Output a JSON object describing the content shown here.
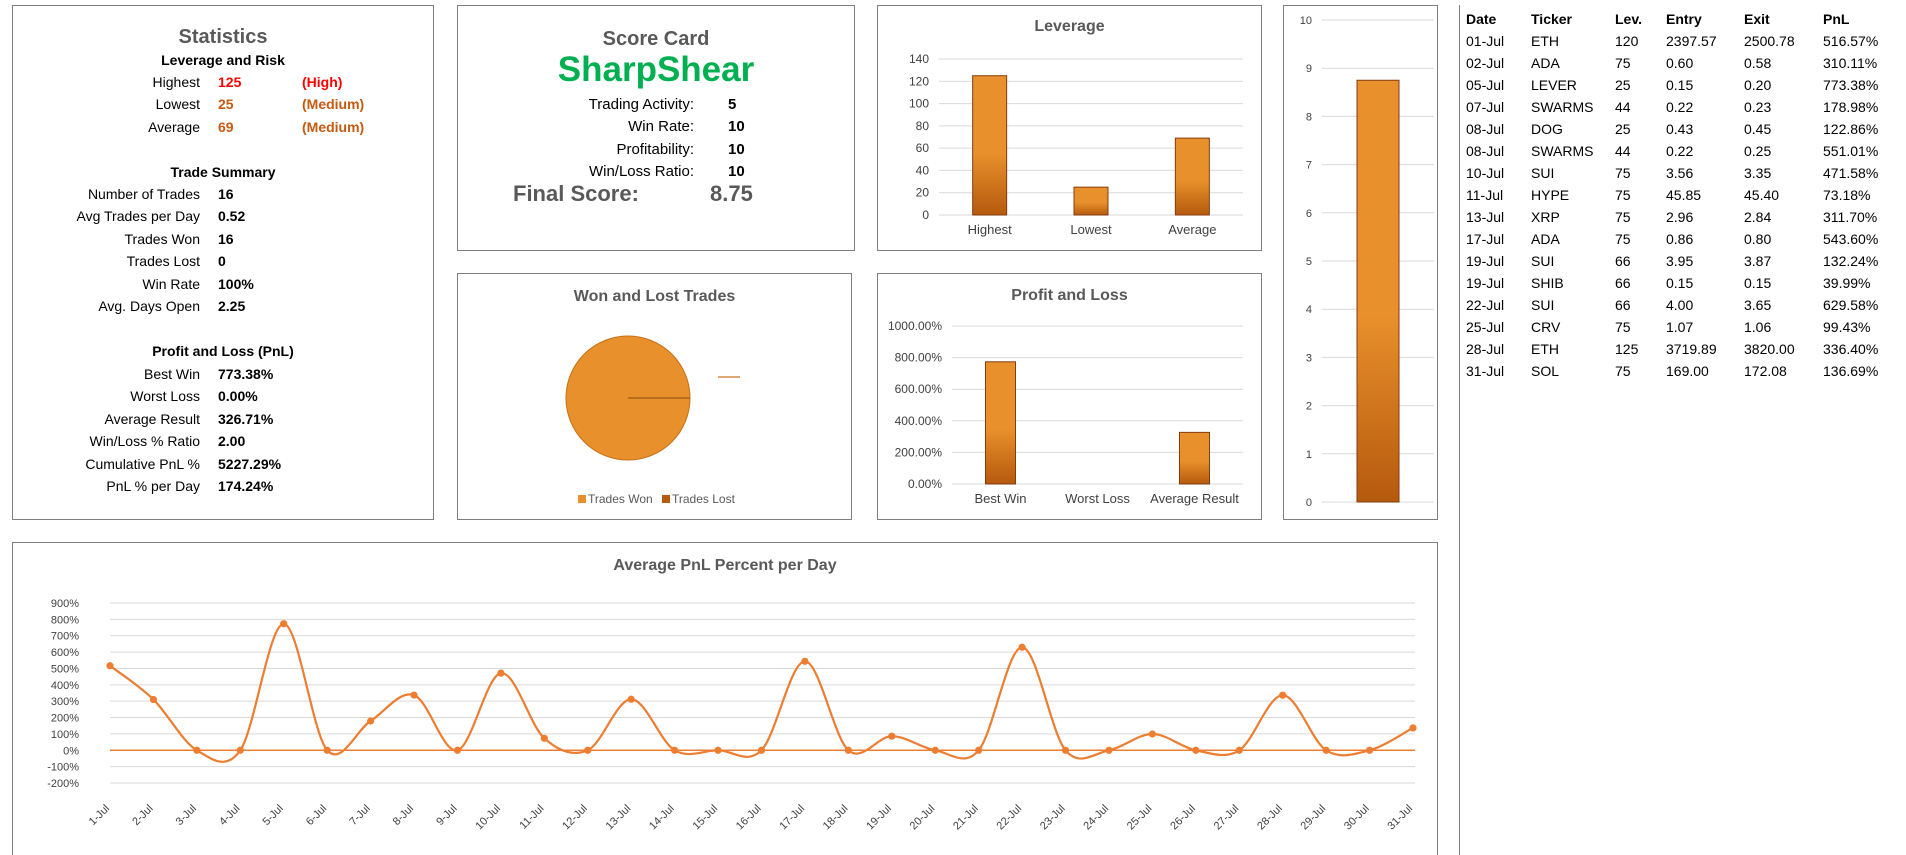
{
  "statistics": {
    "title": "Statistics",
    "leverage_heading": "Leverage and Risk",
    "leverage_rows": [
      {
        "label": "Highest",
        "value": "125",
        "tag": "(High)"
      },
      {
        "label": "Lowest",
        "value": "25",
        "tag": "(Medium)"
      },
      {
        "label": "Average",
        "value": "69",
        "tag": "(Medium)"
      }
    ],
    "trade_heading": "Trade Summary",
    "trade_rows": [
      {
        "label": "Number of Trades",
        "value": "16"
      },
      {
        "label": "Avg Trades per Day",
        "value": "0.52"
      },
      {
        "label": "Trades Won",
        "value": "16"
      },
      {
        "label": "Trades Lost",
        "value": "0"
      },
      {
        "label": "Win Rate",
        "value": "100%"
      },
      {
        "label": "Avg. Days Open",
        "value": "2.25"
      }
    ],
    "pnl_heading": "Profit and Loss (PnL)",
    "pnl_rows": [
      {
        "label": "Best Win",
        "value": "773.38%"
      },
      {
        "label": "Worst Loss",
        "value": "0.00%"
      },
      {
        "label": "Average Result",
        "value": "326.71%"
      },
      {
        "label": "Win/Loss % Ratio",
        "value": "2.00"
      },
      {
        "label": "Cumulative PnL %",
        "value": "5227.29%"
      },
      {
        "label": "PnL % per Day",
        "value": "174.24%"
      }
    ]
  },
  "scorecard": {
    "title": "Score Card",
    "brand": "SharpShear",
    "rows": [
      {
        "label": "Trading Activity:",
        "value": "5"
      },
      {
        "label": "Win Rate:",
        "value": "10"
      },
      {
        "label": "Profitability:",
        "value": "10"
      },
      {
        "label": "Win/Loss Ratio:",
        "value": "10"
      }
    ],
    "final_label": "Final Score:",
    "final_value": "8.75"
  },
  "colors": {
    "bar_top": "#e8912c",
    "bar_bottom": "#b55a0e",
    "line": "#ed7d31",
    "pie_won": "#e8912c",
    "pie_lost": "#b55a0e",
    "brand": "#00b050",
    "high": "#ff0000",
    "medium": "#c55a11"
  },
  "chart_data": [
    {
      "id": "leverage",
      "type": "bar",
      "title": "Leverage",
      "categories": [
        "Highest",
        "Lowest",
        "Average"
      ],
      "values": [
        125,
        25,
        69
      ],
      "ylim": [
        0,
        140
      ],
      "yticks": [
        "0",
        "20",
        "40",
        "60",
        "80",
        "100",
        "120",
        "140"
      ],
      "grid": true
    },
    {
      "id": "score",
      "type": "bar",
      "title": "",
      "categories": [
        ""
      ],
      "values": [
        8.75
      ],
      "ylim": [
        0,
        10
      ],
      "yticks": [
        "0",
        "1",
        "2",
        "3",
        "4",
        "5",
        "6",
        "7",
        "8",
        "9",
        "10"
      ],
      "grid": true
    },
    {
      "id": "wonlost",
      "type": "pie",
      "title": "Won and Lost Trades",
      "labels": [
        "Trades Won",
        "Trades Lost"
      ],
      "values": [
        16,
        0
      ],
      "legend": "bottom"
    },
    {
      "id": "pnl",
      "type": "bar",
      "title": "Profit and Loss",
      "categories": [
        "Best Win",
        "Worst Loss",
        "Average Result"
      ],
      "values": [
        773.38,
        0,
        326.71
      ],
      "ylim": [
        0,
        1000
      ],
      "yticks": [
        "0.00%",
        "200.00%",
        "400.00%",
        "600.00%",
        "800.00%",
        "1000.00%"
      ],
      "grid": true
    },
    {
      "id": "avgpnl",
      "type": "line",
      "title": "Average PnL Percent per Day",
      "categories": [
        "1-Jul",
        "2-Jul",
        "3-Jul",
        "4-Jul",
        "5-Jul",
        "6-Jul",
        "7-Jul",
        "8-Jul",
        "9-Jul",
        "10-Jul",
        "11-Jul",
        "12-Jul",
        "13-Jul",
        "14-Jul",
        "15-Jul",
        "16-Jul",
        "17-Jul",
        "18-Jul",
        "19-Jul",
        "20-Jul",
        "21-Jul",
        "22-Jul",
        "23-Jul",
        "24-Jul",
        "25-Jul",
        "26-Jul",
        "27-Jul",
        "28-Jul",
        "29-Jul",
        "30-Jul",
        "31-Jul"
      ],
      "values": [
        516.57,
        310.11,
        0,
        0,
        773.38,
        0,
        178.98,
        337.43,
        0,
        471.58,
        73.18,
        0,
        311.7,
        0,
        0,
        0,
        543.6,
        0,
        86.12,
        0,
        0,
        629.58,
        0,
        0,
        99.43,
        0,
        0,
        336.4,
        0,
        0,
        136.69
      ],
      "ylim": [
        -200,
        900
      ],
      "yticks": [
        "-200%",
        "-100%",
        "0%",
        "100%",
        "200%",
        "300%",
        "400%",
        "500%",
        "600%",
        "700%",
        "800%",
        "900%"
      ],
      "grid": true
    }
  ],
  "trades": {
    "headers": [
      "Date",
      "Ticker",
      "Lev.",
      "Entry",
      "Exit",
      "PnL"
    ],
    "rows": [
      [
        "01-Jul",
        "ETH",
        "120",
        "2397.57",
        "2500.78",
        "516.57%"
      ],
      [
        "02-Jul",
        "ADA",
        "75",
        "0.60",
        "0.58",
        "310.11%"
      ],
      [
        "05-Jul",
        "LEVER",
        "25",
        "0.15",
        "0.20",
        "773.38%"
      ],
      [
        "07-Jul",
        "SWARMS",
        "44",
        "0.22",
        "0.23",
        "178.98%"
      ],
      [
        "08-Jul",
        "DOG",
        "25",
        "0.43",
        "0.45",
        "122.86%"
      ],
      [
        "08-Jul",
        "SWARMS",
        "44",
        "0.22",
        "0.25",
        "551.01%"
      ],
      [
        "10-Jul",
        "SUI",
        "75",
        "3.56",
        "3.35",
        "471.58%"
      ],
      [
        "11-Jul",
        "HYPE",
        "75",
        "45.85",
        "45.40",
        "73.18%"
      ],
      [
        "13-Jul",
        "XRP",
        "75",
        "2.96",
        "2.84",
        "311.70%"
      ],
      [
        "17-Jul",
        "ADA",
        "75",
        "0.86",
        "0.80",
        "543.60%"
      ],
      [
        "19-Jul",
        "SUI",
        "66",
        "3.95",
        "3.87",
        "132.24%"
      ],
      [
        "19-Jul",
        "SHIB",
        "66",
        "0.15",
        "0.15",
        "39.99%"
      ],
      [
        "22-Jul",
        "SUI",
        "66",
        "4.00",
        "3.65",
        "629.58%"
      ],
      [
        "25-Jul",
        "CRV",
        "75",
        "1.07",
        "1.06",
        "99.43%"
      ],
      [
        "28-Jul",
        "ETH",
        "125",
        "3719.89",
        "3820.00",
        "336.40%"
      ],
      [
        "31-Jul",
        "SOL",
        "75",
        "169.00",
        "172.08",
        "136.69%"
      ]
    ]
  }
}
